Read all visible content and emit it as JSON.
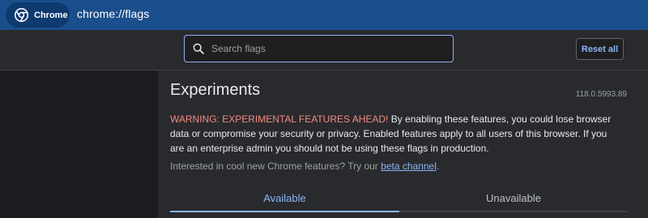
{
  "browser": {
    "chip_label": "Chrome",
    "chip_icon": "chrome-logo-icon",
    "url": "chrome://flags"
  },
  "toolbar": {
    "search_placeholder": "Search flags",
    "search_icon": "search-icon",
    "reset_label": "Reset all"
  },
  "page": {
    "title": "Experiments",
    "version": "118.0.5993.89",
    "warning_head": "WARNING: EXPERIMENTAL FEATURES AHEAD!",
    "warning_body": " By enabling these features, you could lose browser data or compromise your security or privacy. Enabled features apply to all users of this browser. If you are an enterprise admin you should not be using these flags in production.",
    "channel_prefix": "Interested in cool new Chrome features? Try our ",
    "channel_link": "beta channel",
    "channel_suffix": "."
  },
  "tabs": [
    {
      "label": "Available",
      "active": true
    },
    {
      "label": "Unavailable",
      "active": false
    }
  ],
  "colors": {
    "header_bg": "#1b4e8c",
    "accent": "#8ab4f8",
    "warning": "#f28b82",
    "page_bg": "#292a2d"
  }
}
